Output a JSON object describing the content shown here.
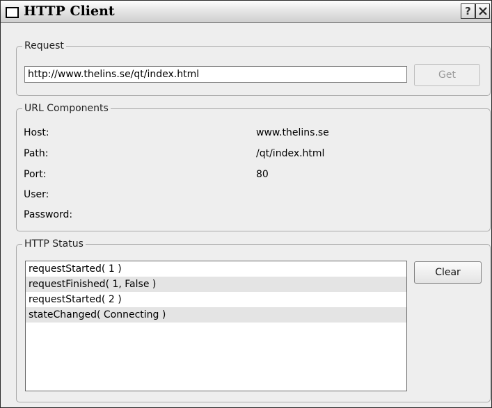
{
  "window": {
    "title": "HTTP Client",
    "help_glyph": "?"
  },
  "request": {
    "group_title": "Request",
    "url_value": "http://www.thelins.se/qt/index.html",
    "get_label": "Get",
    "get_enabled": false
  },
  "url_components": {
    "group_title": "URL Components",
    "rows": [
      {
        "label": "Host:",
        "value": "www.thelins.se"
      },
      {
        "label": "Path:",
        "value": "/qt/index.html"
      },
      {
        "label": "Port:",
        "value": "80"
      },
      {
        "label": "User:",
        "value": ""
      },
      {
        "label": "Password:",
        "value": ""
      }
    ]
  },
  "http_status": {
    "group_title": "HTTP Status",
    "clear_label": "Clear",
    "log": [
      "requestStarted( 1 )",
      "requestFinished( 1, False )",
      "requestStarted( 2 )",
      "stateChanged( Connecting )"
    ]
  },
  "colors": {
    "window_bg": "#eeeeee",
    "group_border": "#a9a9a9",
    "alt_row": "#e4e4e4",
    "disabled_text": "#9a9a9a"
  }
}
